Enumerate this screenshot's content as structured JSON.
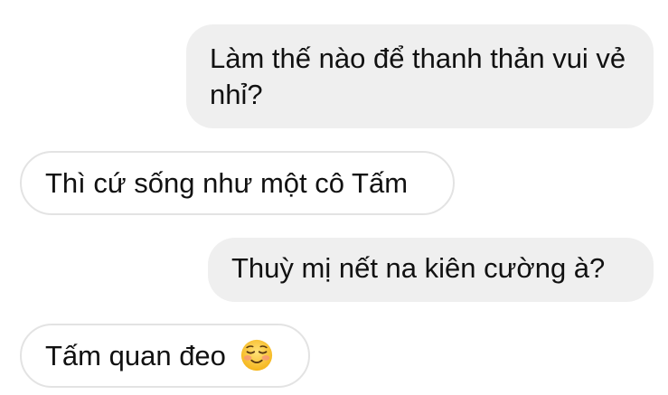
{
  "messages": [
    {
      "side": "sent",
      "text": "Làm thế nào để thanh thản vui vẻ nhỉ?"
    },
    {
      "side": "received",
      "text": "Thì cứ sống như một cô Tấm"
    },
    {
      "side": "sent",
      "text": "Thuỳ mị nết na kiên cường à?"
    },
    {
      "side": "received",
      "text": "Tấm quan đeo",
      "emoji": "smiling-face-emoji"
    }
  ],
  "colors": {
    "sent_bubble": "#efefef",
    "received_border": "#e3e3e3",
    "text": "#111111"
  }
}
